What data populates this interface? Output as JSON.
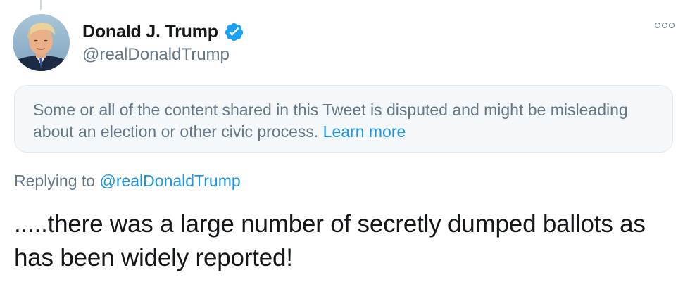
{
  "author": {
    "display_name": "Donald J. Trump",
    "handle": "@realDonaldTrump",
    "verified": true
  },
  "icons": {
    "verified": "verified-badge-icon",
    "more": "more-options-icon"
  },
  "notice": {
    "text": "Some or all of the content shared in this Tweet is disputed and might be misleading about an election or other civic process.",
    "link_label": "Learn more"
  },
  "reply": {
    "prefix": "Replying to",
    "handle": "@realDonaldTrump"
  },
  "tweet": {
    "text": ".....there was a large number of secretly dumped ballots as has been widely reported!"
  },
  "colors": {
    "link": "#1b95e0",
    "secondary_text": "#657786",
    "primary_text": "#14171a",
    "notice_bg": "#f5f8fa",
    "notice_border": "#e1e8ed",
    "verified": "#1da1f2"
  }
}
